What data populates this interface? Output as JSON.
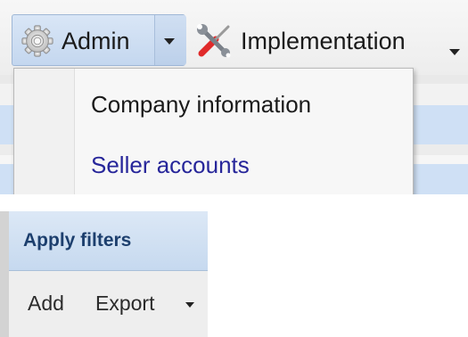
{
  "menubar": {
    "admin_label": "Admin",
    "implementation_label": "Implementation",
    "icons": {
      "admin": "gear-icon",
      "implementation": "tools-icon",
      "dropdown": "caret-down-icon"
    }
  },
  "admin_menu": {
    "items": [
      {
        "label": "Company information",
        "state": "normal"
      },
      {
        "label": "Seller accounts",
        "state": "link"
      }
    ]
  },
  "filters": {
    "apply_label": "Apply filters"
  },
  "actions": {
    "add_label": "Add",
    "export_label": "Export"
  },
  "colors": {
    "active_button": "#c9dbf0",
    "link": "#27269a",
    "apply_text": "#1d3f6e"
  }
}
